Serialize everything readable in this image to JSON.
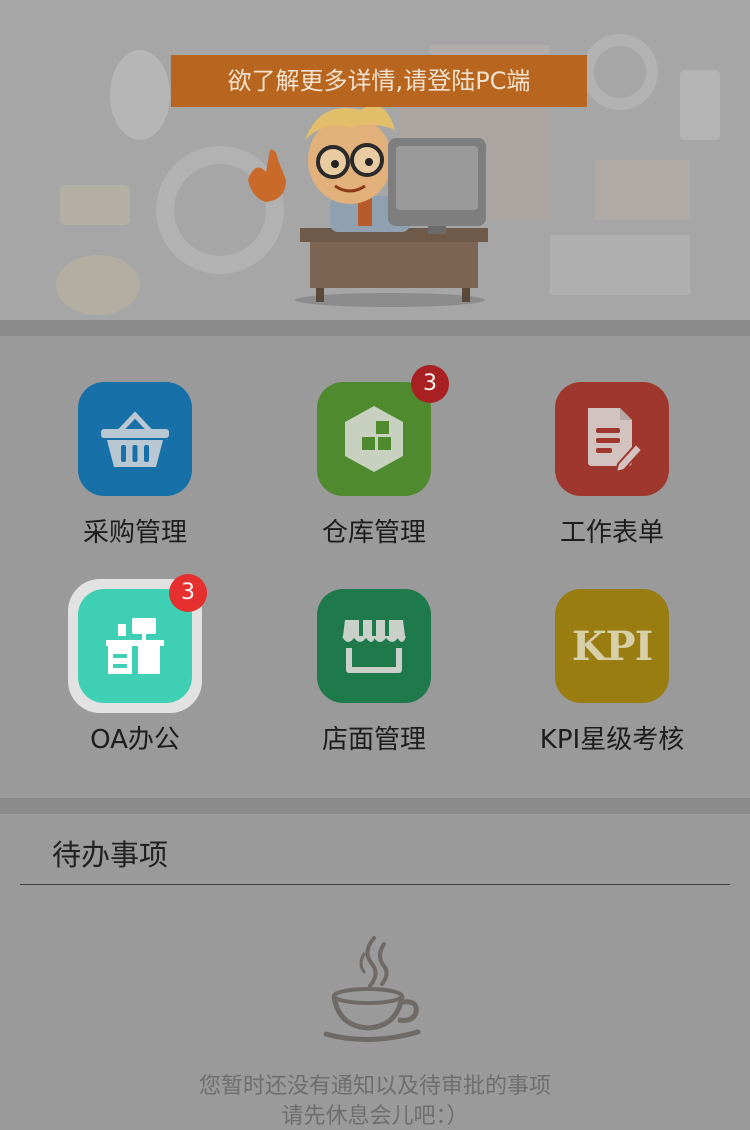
{
  "banner": {
    "notice": "欲了解更多详情,请登陆PC端"
  },
  "grid": {
    "items": [
      {
        "label": "采购管理",
        "color": "#1771a8",
        "icon": "basket-icon"
      },
      {
        "label": "仓库管理",
        "color": "#4f8a2e",
        "icon": "warehouse-icon",
        "badge": "3"
      },
      {
        "label": "工作表单",
        "color": "#a0372e",
        "icon": "form-icon"
      },
      {
        "label": "OA办公",
        "color": "#3fcfb5",
        "icon": "office-desk-icon",
        "badge": "3"
      },
      {
        "label": "店面管理",
        "color": "#1e7a4a",
        "icon": "storefront-icon"
      },
      {
        "label": "KPI星级考核",
        "color": "#9a7d10",
        "icon": "kpi-icon",
        "icon_text": "KPI"
      }
    ]
  },
  "todo": {
    "title": "待办事项",
    "empty_line1": "您暂时还没有通知以及待审批的事项",
    "empty_line2": "请先休息会儿吧：）"
  },
  "colors": {
    "badge_dark": "#a82022",
    "badge_bright": "#e63030",
    "notice_bg": "#b8661f"
  }
}
